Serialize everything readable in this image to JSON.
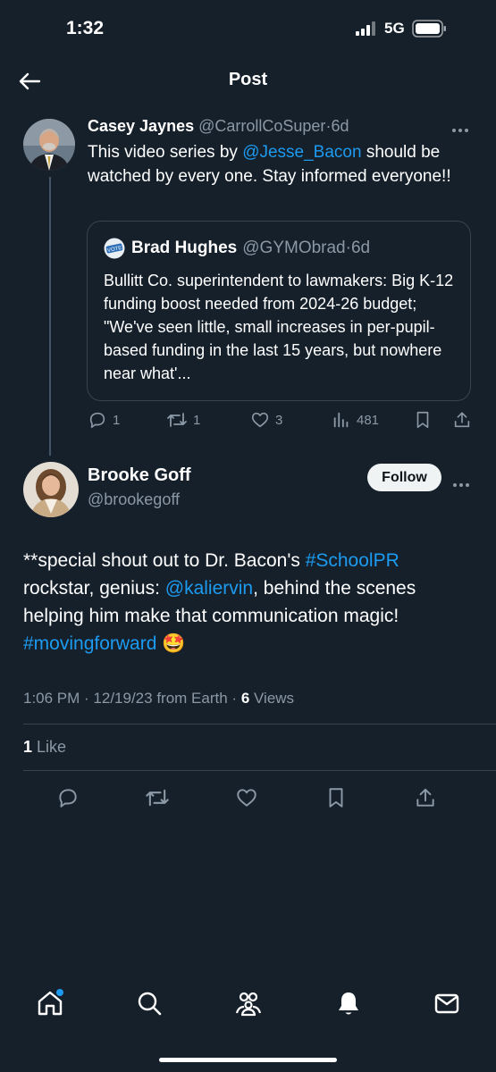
{
  "status_bar": {
    "time": "1:32",
    "network": "5G"
  },
  "nav": {
    "title": "Post"
  },
  "parent_tweet": {
    "author_name": "Casey Jaynes",
    "author_handle": "@CarrollCoSuper",
    "separator": "·",
    "time_ago": "6d",
    "text_before": "This video series by ",
    "mention": "@Jesse_Bacon",
    "text_after": " should be watched by every one.  Stay informed everyone!!",
    "quote": {
      "author_name": "Brad Hughes",
      "author_handle": "@GYMObrad",
      "separator": "·",
      "time_ago": "6d",
      "text": "Bullitt Co. superintendent to lawmakers: Big K-12 funding boost needed from 2024-26 budget; \"We've seen little, small increases in per-pupil-based funding in the last 15 years, but nowhere near what'..."
    },
    "actions": {
      "replies": "1",
      "reposts": "1",
      "likes": "3",
      "views": "481"
    }
  },
  "main_tweet": {
    "author_name": "Brooke Goff",
    "author_handle": "@brookegoff",
    "follow_label": "Follow",
    "text_part1": "**special shout out to Dr. Bacon's ",
    "hashtag1": "#SchoolPR",
    "text_part2": " rockstar, genius: ",
    "mention": "@kaliervin",
    "text_part3": ", behind the scenes helping him make that communication magic! ",
    "hashtag2": "#movingforward",
    "emoji": "🤩",
    "meta_time": "1:06 PM",
    "meta_sep1": " · ",
    "meta_date": "12/19/23",
    "meta_from": " from Earth",
    "meta_sep2": " · ",
    "views_count": "6",
    "views_label": " Views",
    "like_count": "1",
    "like_label": " Like"
  },
  "colors": {
    "background": "#15202b",
    "accent": "#1d9bf0",
    "muted": "#8b98a5",
    "divider": "#38444d"
  },
  "icons": [
    "back-arrow-icon",
    "reply-icon",
    "repost-icon",
    "like-icon",
    "views-icon",
    "bookmark-icon",
    "share-icon",
    "home-icon",
    "search-icon",
    "communities-icon",
    "notifications-icon",
    "messages-icon"
  ]
}
